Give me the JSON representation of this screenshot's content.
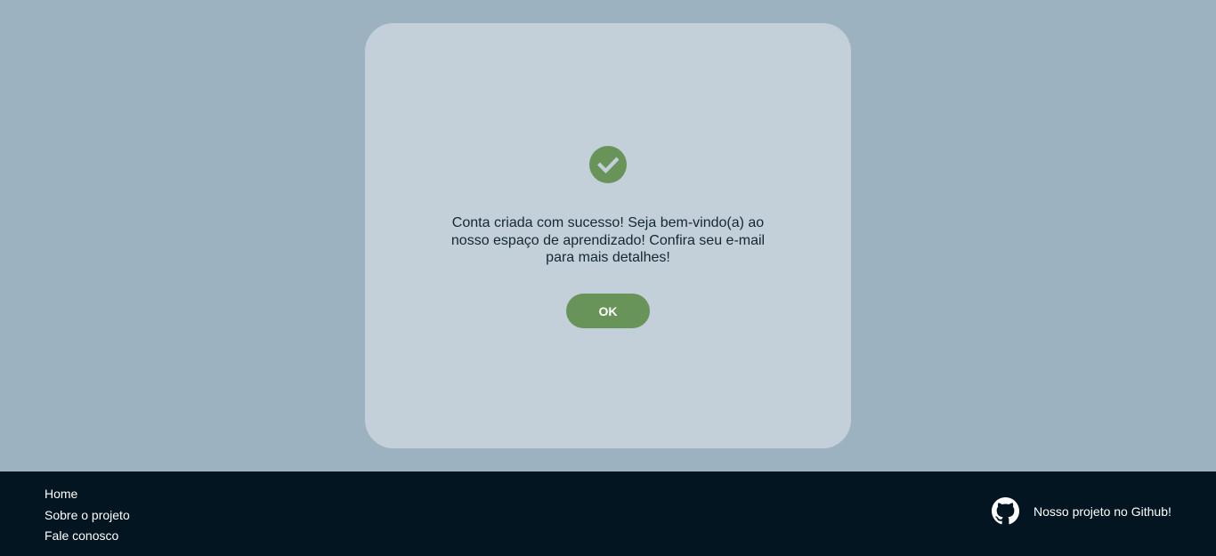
{
  "modal": {
    "icon": "check-circle-icon",
    "message": "Conta criada com sucesso! Seja bem-vindo(a) ao nosso espaço de aprendizado! Confira seu e-mail para mais detalhes!",
    "ok_label": "OK"
  },
  "footer": {
    "links": [
      {
        "label": "Home"
      },
      {
        "label": "Sobre o projeto"
      },
      {
        "label": "Fale conosco"
      }
    ],
    "github": {
      "icon": "github-icon",
      "label": "Nosso projeto no Github!"
    }
  },
  "colors": {
    "page_background": "#9db2c0",
    "modal_background": "#c3d0d9",
    "accent_green": "#699459",
    "footer_background": "#021520",
    "text_dark": "#152733"
  }
}
